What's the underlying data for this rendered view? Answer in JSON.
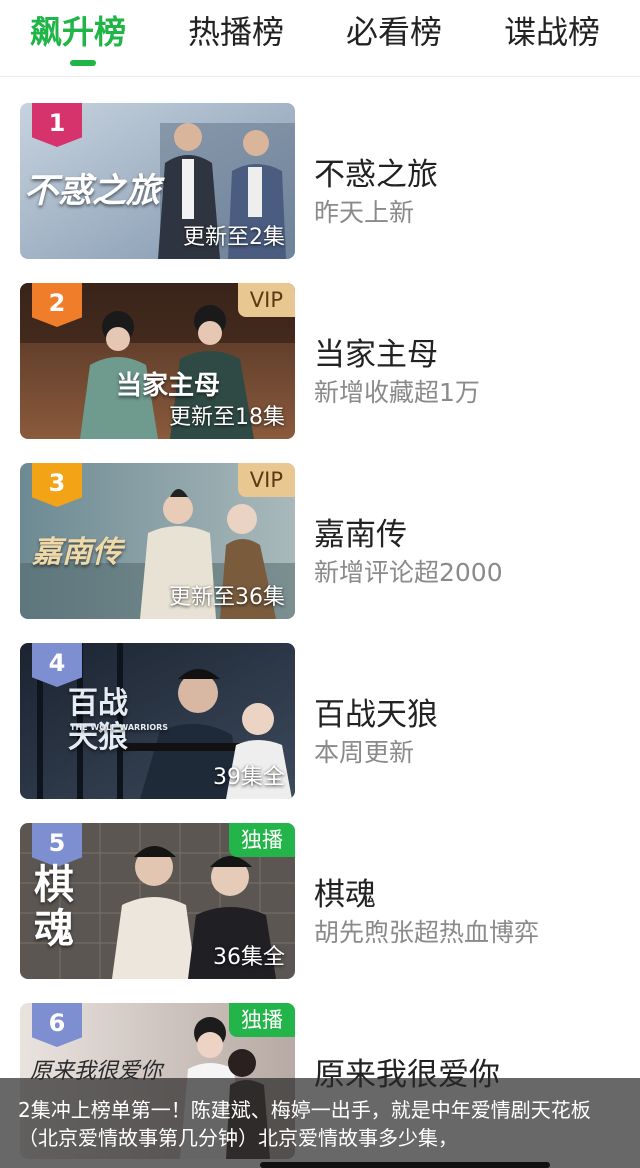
{
  "tabs": [
    {
      "label": "飙升榜",
      "active": true
    },
    {
      "label": "热播榜",
      "active": false
    },
    {
      "label": "必看榜",
      "active": false
    },
    {
      "label": "谍战榜",
      "active": false
    }
  ],
  "colors": {
    "accent": "#1fb547",
    "rank_1": "#d6336c",
    "rank_2": "#f07d2a",
    "rank_3": "#f2a316",
    "rank_other": "#7e8fd1",
    "vip_badge": "#e9c790",
    "exclusive_badge": "#23b54a"
  },
  "list": [
    {
      "rank": "1",
      "poster_text": "不惑之旅",
      "badge": "",
      "episodes": "更新至2集",
      "title": "不惑之旅",
      "subtitle": "昨天上新"
    },
    {
      "rank": "2",
      "poster_text": "当家主母",
      "badge": "VIP",
      "episodes": "更新至18集",
      "title": "当家主母",
      "subtitle": "新增收藏超1万"
    },
    {
      "rank": "3",
      "poster_text": "嘉南传",
      "badge": "VIP",
      "episodes": "更新至36集",
      "title": "嘉南传",
      "subtitle": "新增评论超2000"
    },
    {
      "rank": "4",
      "poster_text": "百战天狼",
      "poster_subtext": "THE WOLF WARRIORS",
      "badge": "",
      "episodes": "39集全",
      "title": "百战天狼",
      "subtitle": "本周更新"
    },
    {
      "rank": "5",
      "poster_text": "棋魂",
      "badge": "独播",
      "episodes": "36集全",
      "title": "棋魂",
      "subtitle": "胡先煦张超热血博弈"
    },
    {
      "rank": "6",
      "poster_text": "原来我很爱你",
      "badge": "独播",
      "episodes": "",
      "title": "原来我很爱你",
      "subtitle": ""
    }
  ],
  "caption": "2集冲上榜单第一！陈建斌、梅婷一出手，就是中年爱情剧天花板（北京爱情故事第几分钟）北京爱情故事多少集，"
}
